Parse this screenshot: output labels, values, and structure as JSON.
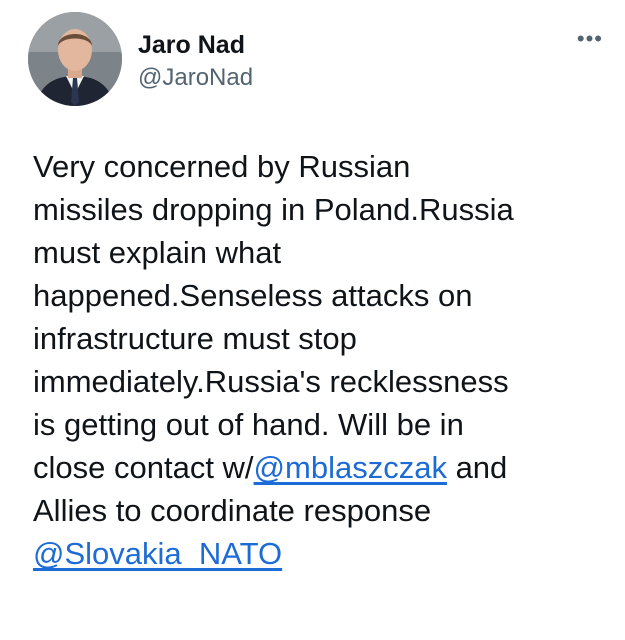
{
  "author": {
    "name": "Jaro Nad",
    "handle": "@JaroNad"
  },
  "more_icon": "more-horizontal-icon",
  "tweet": {
    "line1": "Very concerned by Russian",
    "line2": "missiles dropping in Poland.Russia",
    "line3": "must explain what",
    "line4": "happened.Senseless attacks on",
    "line5": "infrastructure must stop",
    "line6": "immediately.Russia's recklessness",
    "line7": "is getting out of hand. Will be in",
    "line8_prefix": "close contact w/",
    "mention1": "@mblaszczak",
    "line8_suffix": " and",
    "line9": "Allies to coordinate response",
    "mention2": "@Slovakia_NATO"
  },
  "colors": {
    "text": "#0f1419",
    "secondary": "#536471",
    "link": "#1d6bd6"
  }
}
